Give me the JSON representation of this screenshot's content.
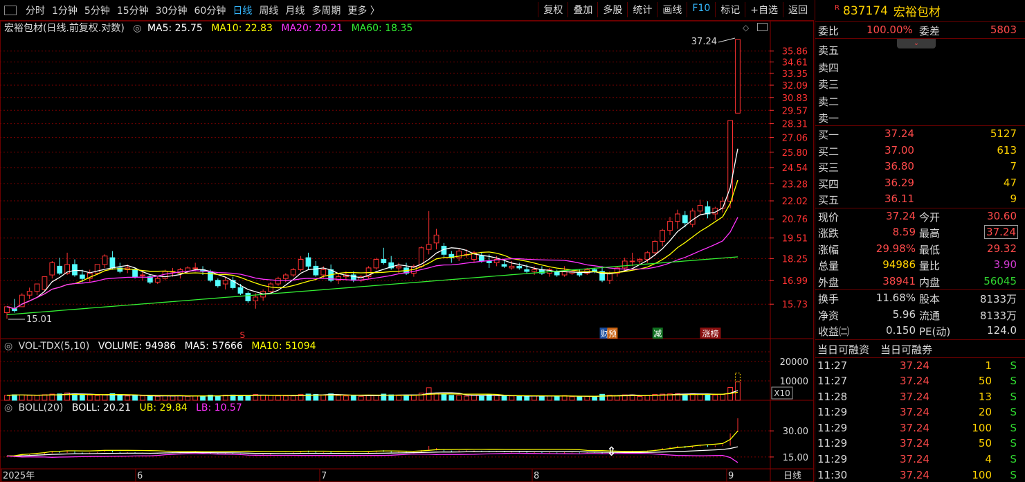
{
  "toolbar": {
    "periods": [
      "分时",
      "1分钟",
      "5分钟",
      "15分钟",
      "30分钟",
      "60分钟",
      "日线",
      "周线",
      "月线",
      "多周期",
      "更多 〉"
    ],
    "active_period": "日线",
    "tools": [
      "复权",
      "叠加",
      "多股",
      "统计",
      "画线",
      "F10",
      "标记",
      "+自选",
      "返回"
    ]
  },
  "main_pane": {
    "title": "宏裕包材(日线.前复权.对数)",
    "ma5": "MA5: 25.75",
    "ma10": "MA10: 22.83",
    "ma20": "MA20: 20.21",
    "ma60": "MA60: 18.35",
    "price_ticks": [
      "35.86",
      "34.61",
      "33.35",
      "32.09",
      "30.83",
      "29.57",
      "28.31",
      "27.06",
      "25.80",
      "24.54",
      "23.28",
      "22.02",
      "20.76",
      "19.51",
      "18.25",
      "16.99",
      "15.73"
    ],
    "high_label": "37.24",
    "low_label": "15.01",
    "markers": {
      "s": "S",
      "cai": "财",
      "yu": "预",
      "jian": "减",
      "zhang": "涨榜"
    }
  },
  "volume_pane": {
    "title": "VOL-TDX(5,10)",
    "volume": "VOLUME: 94986",
    "ma5": "MA5: 57666",
    "ma10": "MA10: 51094",
    "ticks": [
      "20000",
      "10000"
    ],
    "unit": "X10"
  },
  "boll_pane": {
    "title": "BOLL(20)",
    "boll": "BOLL: 20.21",
    "ub": "UB: 29.84",
    "lb": "LB: 10.57",
    "ticks": [
      "30.00",
      "15.00"
    ]
  },
  "x_axis": {
    "labels": [
      "2025年",
      "6",
      "7",
      "8",
      "9"
    ],
    "period_label": "日线"
  },
  "quote": {
    "code": "837174",
    "name": "宏裕包材",
    "r_mark": "R",
    "weibi_label": "委比",
    "weibi_value": "100.00%",
    "weicha_label": "委差",
    "weicha_value": "5803",
    "sell": [
      {
        "label": "卖五",
        "price": "",
        "vol": ""
      },
      {
        "label": "卖四",
        "price": "",
        "vol": ""
      },
      {
        "label": "卖三",
        "price": "",
        "vol": ""
      },
      {
        "label": "卖二",
        "price": "",
        "vol": ""
      },
      {
        "label": "卖一",
        "price": "",
        "vol": ""
      }
    ],
    "buy": [
      {
        "label": "买一",
        "price": "37.24",
        "vol": "5127"
      },
      {
        "label": "买二",
        "price": "37.00",
        "vol": "613"
      },
      {
        "label": "买三",
        "price": "36.80",
        "vol": "7"
      },
      {
        "label": "买四",
        "price": "36.29",
        "vol": "47"
      },
      {
        "label": "买五",
        "price": "36.11",
        "vol": "9"
      }
    ],
    "stats": [
      {
        "l1": "现价",
        "v1": "37.24",
        "c1": "red",
        "l2": "今开",
        "v2": "30.60",
        "c2": "red"
      },
      {
        "l1": "涨跌",
        "v1": "8.59",
        "c1": "red",
        "l2": "最高",
        "v2": "37.24",
        "c2": "red"
      },
      {
        "l1": "涨幅",
        "v1": "29.98%",
        "c1": "red",
        "l2": "最低",
        "v2": "29.32",
        "c2": "red"
      },
      {
        "l1": "总量",
        "v1": "94986",
        "c1": "yel",
        "l2": "量比",
        "v2": "3.90",
        "c2": "mag"
      },
      {
        "l1": "外盘",
        "v1": "38941",
        "c1": "red",
        "l2": "内盘",
        "v2": "56045",
        "c2": "grn"
      }
    ],
    "stats2": [
      {
        "l1": "换手",
        "v1": "11.68%",
        "l2": "股本",
        "v2": "8133万"
      },
      {
        "l1": "净资",
        "v1": "5.96",
        "l2": "流通",
        "v2": "8133万"
      },
      {
        "l1": "收益㈡",
        "v1": "0.150",
        "l2": "PE(动)",
        "v2": "124.0"
      }
    ],
    "margin_tabs": [
      "当日可融资",
      "当日可融券"
    ],
    "ticks": [
      {
        "time": "11:27",
        "price": "37.24",
        "vol": "1",
        "side": "S"
      },
      {
        "time": "11:27",
        "price": "37.24",
        "vol": "50",
        "side": "S"
      },
      {
        "time": "11:28",
        "price": "37.24",
        "vol": "13",
        "side": "S"
      },
      {
        "time": "11:29",
        "price": "37.24",
        "vol": "20",
        "side": "S"
      },
      {
        "time": "11:29",
        "price": "37.24",
        "vol": "100",
        "side": "S"
      },
      {
        "time": "11:29",
        "price": "37.24",
        "vol": "50",
        "side": "S"
      },
      {
        "time": "11:29",
        "price": "37.24",
        "vol": "4",
        "side": "S"
      },
      {
        "time": "11:30",
        "price": "37.24",
        "vol": "100",
        "side": "S"
      }
    ]
  },
  "chart_data": {
    "type": "candlestick",
    "scale": "log",
    "dates_axis": [
      "2025年",
      "6",
      "7",
      "8",
      "9"
    ],
    "ohlc": [
      [
        15.3,
        15.6,
        15.0,
        15.6
      ],
      [
        15.5,
        16.0,
        15.3,
        15.4
      ],
      [
        15.6,
        16.3,
        15.6,
        16.2
      ],
      [
        16.2,
        16.6,
        16.0,
        16.4
      ],
      [
        16.4,
        16.8,
        16.2,
        16.8
      ],
      [
        16.5,
        17.2,
        16.4,
        17.2
      ],
      [
        17.3,
        18.1,
        17.1,
        18.0
      ],
      [
        17.8,
        18.3,
        17.3,
        17.4
      ],
      [
        17.4,
        18.6,
        17.3,
        17.9
      ],
      [
        17.9,
        18.2,
        17.2,
        17.3
      ],
      [
        17.3,
        17.6,
        16.9,
        17.1
      ],
      [
        17.1,
        17.6,
        16.9,
        17.4
      ],
      [
        17.4,
        17.9,
        17.3,
        17.9
      ],
      [
        17.9,
        18.5,
        17.7,
        18.4
      ],
      [
        18.3,
        18.7,
        17.6,
        17.7
      ],
      [
        17.7,
        18.0,
        17.4,
        17.5
      ],
      [
        17.6,
        17.9,
        17.4,
        17.7
      ],
      [
        17.6,
        17.7,
        17.1,
        17.2
      ],
      [
        17.3,
        17.5,
        17.0,
        17.3
      ],
      [
        17.2,
        17.3,
        16.8,
        16.9
      ],
      [
        16.9,
        17.2,
        16.8,
        17.1
      ],
      [
        17.1,
        17.6,
        17.0,
        17.5
      ],
      [
        17.5,
        17.7,
        17.2,
        17.5
      ],
      [
        17.4,
        17.7,
        17.1,
        17.6
      ],
      [
        17.5,
        17.8,
        17.4,
        17.7
      ],
      [
        17.7,
        18.0,
        17.5,
        17.7
      ],
      [
        17.6,
        17.8,
        17.3,
        17.5
      ],
      [
        17.5,
        17.6,
        16.9,
        17.0
      ],
      [
        17.0,
        17.1,
        16.6,
        16.7
      ],
      [
        16.8,
        17.2,
        16.5,
        17.0
      ],
      [
        17.0,
        17.2,
        16.5,
        16.6
      ],
      [
        16.6,
        16.8,
        16.2,
        16.3
      ],
      [
        16.3,
        16.4,
        15.8,
        15.9
      ],
      [
        15.9,
        16.3,
        15.5,
        16.1
      ],
      [
        16.1,
        16.5,
        15.9,
        16.4
      ],
      [
        16.4,
        16.9,
        16.3,
        16.8
      ],
      [
        16.8,
        17.2,
        16.7,
        17.1
      ],
      [
        17.1,
        17.4,
        16.9,
        17.3
      ],
      [
        17.3,
        17.7,
        17.2,
        17.6
      ],
      [
        17.6,
        18.4,
        17.5,
        18.2
      ],
      [
        18.3,
        18.6,
        17.6,
        17.8
      ],
      [
        17.8,
        18.1,
        17.2,
        17.3
      ],
      [
        17.3,
        17.8,
        17.1,
        17.6
      ],
      [
        17.6,
        17.9,
        16.9,
        17.0
      ],
      [
        17.0,
        17.4,
        16.8,
        17.2
      ],
      [
        17.2,
        17.5,
        17.0,
        17.3
      ],
      [
        17.3,
        17.5,
        16.9,
        17.0
      ],
      [
        17.0,
        17.3,
        16.9,
        17.2
      ],
      [
        17.2,
        17.8,
        17.1,
        17.7
      ],
      [
        17.7,
        18.3,
        17.6,
        18.2
      ],
      [
        18.2,
        18.9,
        17.9,
        18.0
      ],
      [
        18.0,
        18.4,
        17.6,
        17.7
      ],
      [
        17.7,
        18.0,
        17.4,
        17.8
      ],
      [
        17.7,
        18.0,
        17.3,
        17.4
      ],
      [
        17.4,
        17.9,
        17.2,
        17.8
      ],
      [
        17.8,
        19.0,
        17.7,
        18.9
      ],
      [
        18.8,
        21.3,
        18.5,
        19.1
      ],
      [
        19.2,
        20.1,
        18.8,
        19.7
      ],
      [
        19.0,
        19.2,
        18.3,
        18.5
      ],
      [
        18.5,
        18.7,
        18.0,
        18.3
      ],
      [
        18.3,
        18.8,
        18.1,
        18.7
      ],
      [
        18.5,
        18.8,
        18.3,
        18.5
      ],
      [
        18.2,
        18.7,
        18.0,
        18.6
      ],
      [
        18.4,
        18.6,
        18.0,
        18.1
      ],
      [
        18.1,
        18.5,
        17.7,
        18.0
      ],
      [
        18.0,
        18.4,
        17.8,
        18.2
      ],
      [
        17.9,
        18.2,
        17.7,
        17.8
      ],
      [
        17.7,
        18.1,
        17.6,
        17.8
      ],
      [
        17.8,
        18.0,
        17.6,
        17.7
      ],
      [
        17.6,
        17.9,
        17.4,
        17.5
      ],
      [
        17.5,
        17.8,
        17.3,
        17.6
      ],
      [
        17.6,
        17.8,
        17.3,
        17.4
      ],
      [
        17.4,
        17.7,
        17.2,
        17.6
      ],
      [
        17.5,
        17.6,
        17.2,
        17.3
      ],
      [
        17.3,
        17.8,
        17.2,
        17.5
      ],
      [
        17.4,
        17.6,
        17.3,
        17.5
      ],
      [
        17.4,
        17.6,
        17.2,
        17.3
      ],
      [
        17.4,
        17.7,
        17.3,
        17.6
      ],
      [
        17.6,
        17.7,
        17.4,
        17.5
      ],
      [
        17.5,
        17.8,
        16.9,
        17.0
      ],
      [
        17.0,
        17.5,
        16.8,
        17.4
      ],
      [
        17.4,
        17.8,
        17.2,
        17.7
      ],
      [
        17.7,
        18.3,
        17.5,
        18.1
      ],
      [
        18.1,
        18.6,
        17.8,
        18.1
      ],
      [
        18.1,
        18.3,
        17.9,
        18.2
      ],
      [
        18.2,
        18.7,
        18.0,
        18.6
      ],
      [
        18.6,
        19.4,
        18.4,
        19.3
      ],
      [
        19.3,
        20.1,
        19.0,
        20.0
      ],
      [
        20.0,
        20.9,
        19.7,
        20.6
      ],
      [
        20.6,
        21.4,
        20.1,
        21.1
      ],
      [
        21.0,
        21.3,
        20.2,
        20.5
      ],
      [
        20.4,
        21.5,
        20.2,
        21.3
      ],
      [
        21.3,
        22.1,
        21.0,
        21.7
      ],
      [
        21.6,
        22.0,
        20.8,
        21.1
      ],
      [
        21.1,
        21.6,
        20.7,
        21.5
      ],
      [
        21.5,
        22.3,
        21.2,
        22.0
      ],
      [
        22.0,
        28.6,
        21.5,
        28.6
      ],
      [
        29.3,
        37.24,
        29.32,
        37.24
      ]
    ],
    "ma5_last": 25.75,
    "ma10_last": 22.83,
    "ma20_last": 20.21,
    "ma60_last": 18.35,
    "y_range": [
      15.01,
      37.24
    ],
    "volume_last": 94986,
    "vol_ma5_last": 57666,
    "vol_ma10_last": 51094,
    "boll_last": 20.21,
    "ub_last": 29.84,
    "lb_last": 10.57
  }
}
